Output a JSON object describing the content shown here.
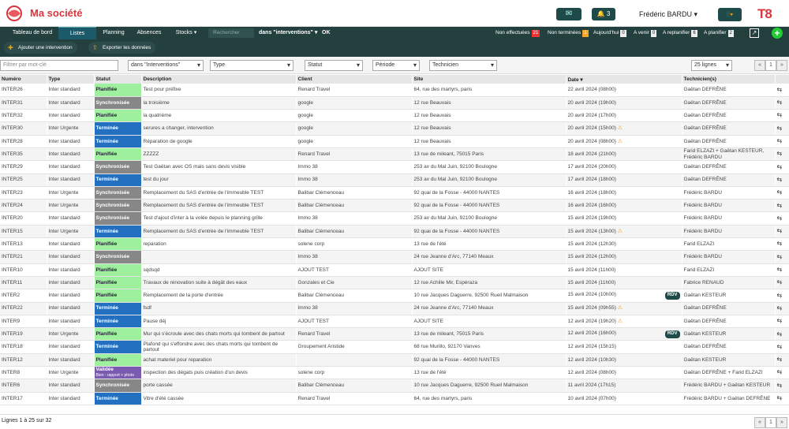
{
  "brand": {
    "name": "Ma société"
  },
  "topbar": {
    "bell_count": "3",
    "user_name": "Frédéric BARDU",
    "app_logo": "T8"
  },
  "nav": {
    "items": [
      "Tableau de bord",
      "Listes",
      "Planning",
      "Absences",
      "Stocks"
    ],
    "search_placeholder": "Rechercher",
    "dans": "dans \"interventions\"",
    "ok": "OK",
    "stats": [
      {
        "label": "Non effectuées",
        "count": "21"
      },
      {
        "label": "Non terminées",
        "count": "1"
      },
      {
        "label": "Aujourd'hui",
        "count": "0"
      },
      {
        "label": "A venir",
        "count": "0"
      },
      {
        "label": "A replanifier",
        "count": "6"
      },
      {
        "label": "A planifier",
        "count": "2"
      }
    ]
  },
  "actions": {
    "add": "Ajouter une intervention",
    "export": "Exporter les données"
  },
  "filters": {
    "keyword_placeholder": "Filtrer par mot-clé",
    "dans": "dans \"Interventions\"",
    "type": "Type",
    "statut": "Statut",
    "periode": "Période",
    "technicien": "Technicien",
    "lines": "25 lignes",
    "page": "1"
  },
  "columns": [
    "Numéro",
    "Type",
    "Statut",
    "Description",
    "Client",
    "Site",
    "Date",
    "Technicien(s)"
  ],
  "rows": [
    {
      "num": "INTER26",
      "type": "Inter standard",
      "status": "Planifiée",
      "desc": "Test pour préfixe",
      "client": "Renard Travel",
      "site": "64, rue des martyrs, paris",
      "date": "22 avril 2024 (08h00)",
      "tech": "Gaëtan DEFRÊNE"
    },
    {
      "num": "INTER31",
      "type": "Inter standard",
      "status": "Synchronisée",
      "desc": "la troisième",
      "client": "google",
      "site": "12 rue Beauvais",
      "date": "20 avril 2024 (19h00)",
      "tech": "Gaëtan DEFRÊNE"
    },
    {
      "num": "INTER32",
      "type": "Inter standard",
      "status": "Planifiée",
      "desc": "la quatrième",
      "client": "google",
      "site": "12 rue Beauvais",
      "date": "20 avril 2024 (17h00)",
      "tech": "Gaëtan DEFRÊNE"
    },
    {
      "num": "INTER30",
      "type": "Inter Urgente",
      "status": "Terminée",
      "desc": "serures a changer, intervention",
      "client": "google",
      "site": "12 rue Beauvais",
      "date": "20 avril 2024 (15h00)",
      "warn": true,
      "tech": "Gaëtan DEFRÊNE"
    },
    {
      "num": "INTER28",
      "type": "Inter standard",
      "status": "Terminée",
      "desc": "Réparation de google",
      "client": "google",
      "site": "12 rue Beauvais",
      "date": "20 avril 2024 (08h00)",
      "warn": true,
      "tech": "Gaëtan DEFRÊNE"
    },
    {
      "num": "INTER35",
      "type": "Inter standard",
      "status": "Planifiée",
      "desc": "ZZZZZ",
      "client": "Renard Travel",
      "site": "13 rue de mileant, 75015 Paris",
      "date": "18 avril 2024 (21h00)",
      "tech": "Farid ELZAZI + Gaëtan KESTEUR, Frédéric BARDU"
    },
    {
      "num": "INTER29",
      "type": "Inter standard",
      "status": "Synchronisée",
      "desc": "Test Gaëtan avec OS mais sans devis visible",
      "client": "Immo 38",
      "site": "253 av du Mal Juin, 92100 Boulogne",
      "date": "17 avril 2024 (20h00)",
      "tech": "Gaëtan DEFRÊNE"
    },
    {
      "num": "INTER25",
      "type": "Inter standard",
      "status": "Terminée",
      "desc": "test du jour",
      "client": "Immo 38",
      "site": "253 av du Mal Juin, 92100 Boulogne",
      "date": "17 avril 2024 (18h00)",
      "tech": "Gaëtan DEFRÊNE"
    },
    {
      "num": "INTER23",
      "type": "Inter Urgente",
      "status": "Synchronisée",
      "desc": "Remplacement du SAS d'entrée de l'immeuble TEST",
      "client": "Balibar Clémenceau",
      "site": "92 quai de la Fosse - 44000 NANTES",
      "date": "16 avril 2024 (18h00)",
      "tech": "Frédéric BARDU"
    },
    {
      "num": "INTER24",
      "type": "Inter Urgente",
      "status": "Synchronisée",
      "desc": "Remplacement du SAS d'entrée de l'immeuble TEST",
      "client": "Balibar Clémenceau",
      "site": "92 quai de la Fosse - 44000 NANTES",
      "date": "16 avril 2024 (16h00)",
      "tech": "Frédéric BARDU"
    },
    {
      "num": "INTER20",
      "type": "Inter standard",
      "status": "Synchronisée",
      "desc": "Test d'ajout d'inter à la volée depuis le planning grille",
      "client": "Immo 38",
      "site": "253 av du Mal Juin, 92100 Boulogne",
      "date": "15 avril 2024 (19h00)",
      "tech": "Frédéric BARDU"
    },
    {
      "num": "INTER15",
      "type": "Inter Urgente",
      "status": "Terminée",
      "desc": "Remplacement du SAS d'entrée de l'immeuble TEST",
      "client": "Balibar Clémenceau",
      "site": "92 quai de la Fosse - 44000 NANTES",
      "date": "15 avril 2024 (13h00)",
      "warn": true,
      "tech": "Frédéric BARDU"
    },
    {
      "num": "INTER13",
      "type": "Inter standard",
      "status": "Planifiée",
      "desc": "reparation",
      "client": "solene corp",
      "site": "13 rue de l'été",
      "date": "15 avril 2024 (12h30)",
      "tech": "Farid ELZAZI"
    },
    {
      "num": "INTER21",
      "type": "Inter standard",
      "status": "Synchronisée",
      "desc": "",
      "client": "Immo 38",
      "site": "24 rue Jeanne d'Arc, 77140 Meaux",
      "date": "15 avril 2024 (12h00)",
      "tech": "Frédéric BARDU"
    },
    {
      "num": "INTER10",
      "type": "Inter standard",
      "status": "Planifiée",
      "desc": "sqdsqd",
      "client": "AJOUT TEST",
      "site": "AJOUT SITE",
      "date": "15 avril 2024 (11h00)",
      "tech": "Farid ELZAZI"
    },
    {
      "num": "INTER11",
      "type": "Inter standard",
      "status": "Planifiée",
      "desc": "Travaux de rénovation suite à dégât des eaux",
      "client": "Gonzales et Cie",
      "site": "12 rue Achille Mir, Espéraza",
      "date": "15 avril 2024 (11h00)",
      "tech": "Fabrice RENAUD"
    },
    {
      "num": "INTER2",
      "type": "Inter standard",
      "status": "Planifiée",
      "desc": "Remplacement de la porte d'entrée",
      "client": "Balibar Clémenceau",
      "site": "10 rue Jacques Daguerre, 92500 Rueil Malmaison",
      "date": "15 avril 2024 (10h00)",
      "rdv": true,
      "tech": "Gaëtan KESTEUR"
    },
    {
      "num": "INTER22",
      "type": "Inter standard",
      "status": "Terminée",
      "desc": "fsdf",
      "client": "Immo 38",
      "site": "24 rue Jeanne d'Arc, 77140 Meaux",
      "date": "15 avril 2024 (09h55)",
      "warn": true,
      "tech": "Gaëtan DEFRÊNE"
    },
    {
      "num": "INTER9",
      "type": "Inter standard",
      "status": "Terminée",
      "desc": "Pause déj",
      "client": "AJOUT TEST",
      "site": "AJOUT SITE",
      "date": "12 avril 2024 (19h20)",
      "warn": true,
      "tech": "Gaëtan DEFRÊNE"
    },
    {
      "num": "INTER19",
      "type": "Inter Urgente",
      "status": "Planifiée",
      "desc": "Mur qui s'écroule avec des chats morts qui tombent de partout",
      "client": "Renard Travel",
      "site": "13 rue de mileant, 75015 Paris",
      "date": "12 avril 2024 (16h00)",
      "rdv": true,
      "tech": "Gaëtan KESTEUR"
    },
    {
      "num": "INTER18",
      "type": "Inter standard",
      "status": "Terminée",
      "desc": "Plafond qui s'effondre avec des chats morts qui tombent de partout",
      "client": "Groupement Aristide",
      "site": "68 rue Murillo, 92170 Vanves",
      "date": "12 avril 2024 (15h15)",
      "tech": "Gaëtan DEFRÊNE"
    },
    {
      "num": "INTER12",
      "type": "Inter standard",
      "status": "Planifiée",
      "desc": "achat materiel pour reparation",
      "client": "",
      "site": "92 quai de la Fosse - 44000 NANTES",
      "date": "12 avril 2024 (10h30)",
      "tech": "Gaëtan KESTEUR"
    },
    {
      "num": "INTER8",
      "type": "Inter Urgente",
      "status": "Validée",
      "status_sub": "Bien - rapport + photo",
      "desc": "inspection des dégats puis création d'un devis",
      "client": "solene corp",
      "site": "13 rue de l'été",
      "date": "12 avril 2024 (08h00)",
      "tech": "Gaëtan DEFRÊNE + Farid ELZAZI"
    },
    {
      "num": "INTER6",
      "type": "Inter standard",
      "status": "Synchronisée",
      "desc": "porte cassée",
      "client": "Balibar Clémenceau",
      "site": "10 rue Jacques Daguerre, 92500 Rueil Malmaison",
      "date": "11 avril 2024 (17h15)",
      "tech": "Frédéric BARDU + Gaëtan KESTEUR"
    },
    {
      "num": "INTER17",
      "type": "Inter standard",
      "status": "Terminée",
      "desc": "Vitre d'été cassée",
      "client": "Renard Travel",
      "site": "64, rue des martyrs, paris",
      "date": "10 avril 2024 (07h00)",
      "tech": "Frédéric BARDU + Gaëtan DEFRÊNE"
    }
  ],
  "footer": {
    "summary": "Lignes 1 à 25 sur 32"
  }
}
